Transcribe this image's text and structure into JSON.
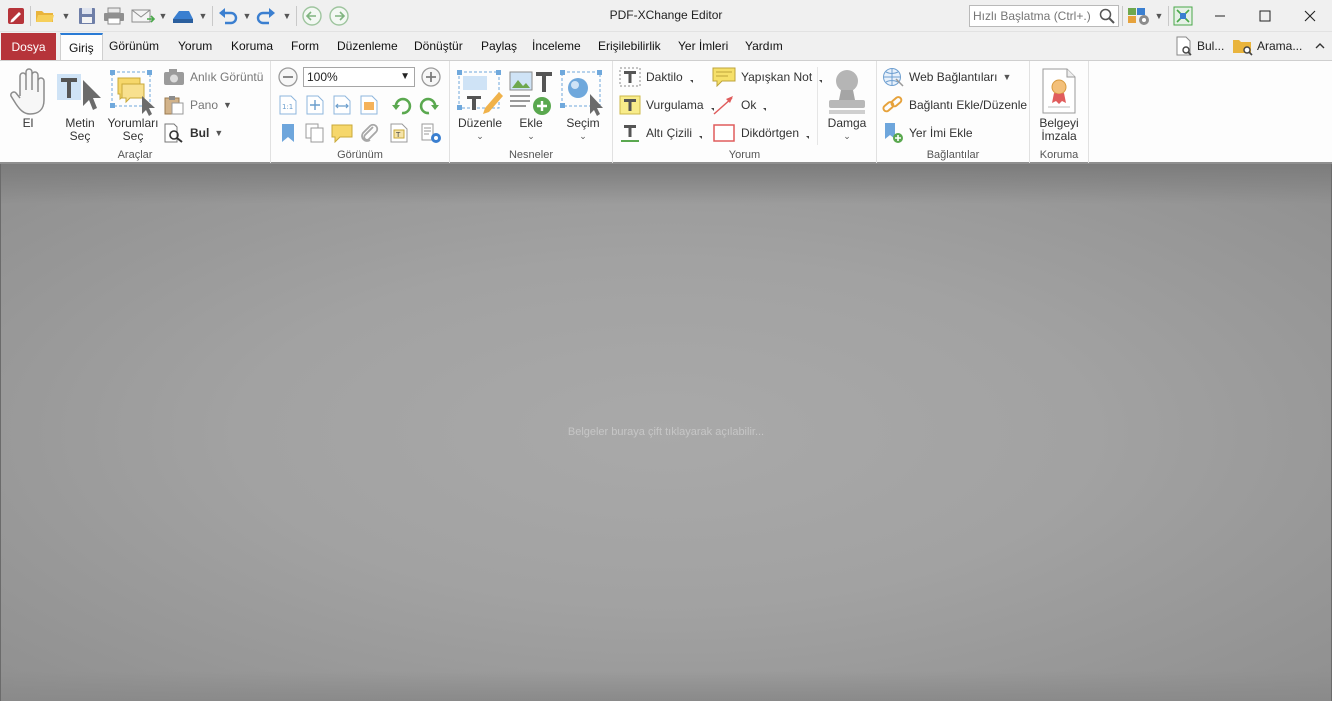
{
  "window": {
    "title": "PDF-XChange Editor",
    "quick_search_placeholder": "Hızlı Başlatma (Ctrl+.)"
  },
  "menu": {
    "file": "Dosya",
    "tabs": [
      "Giriş",
      "Görünüm",
      "Yorum",
      "Koruma",
      "Form",
      "Düzenleme",
      "Dönüştür",
      "Paylaş",
      "İnceleme",
      "Erişilebilirlik",
      "Yer İmleri",
      "Yardım"
    ],
    "active_tab": "Giriş",
    "right_find": "Bul...",
    "right_search": "Arama..."
  },
  "ribbon": {
    "tools": {
      "label": "Araçlar",
      "hand": "El",
      "select_text_1": "Metin",
      "select_text_2": "Seç",
      "select_comments_1": "Yorumları",
      "select_comments_2": "Seç",
      "snapshot": "Anlık Görüntü",
      "clipboard": "Pano",
      "find": "Bul"
    },
    "view": {
      "label": "Görünüm",
      "zoom": "100%"
    },
    "objects": {
      "label": "Nesneler",
      "edit": "Düzenle",
      "add": "Ekle",
      "selection": "Seçim"
    },
    "comment": {
      "label": "Yorum",
      "typewriter": "Daktilo",
      "highlight": "Vurgulama",
      "underline": "Altı Çizili",
      "sticky_note": "Yapışkan Not",
      "arrow": "Ok",
      "rectangle": "Dikdörtgen",
      "stamp": "Damga"
    },
    "links": {
      "label": "Bağlantılar",
      "web_links": "Web Bağlantıları",
      "add_edit_link": "Bağlantı Ekle/Düzenle",
      "add_bookmark": "Yer İmi Ekle"
    },
    "protect": {
      "label": "Koruma",
      "sign_1": "Belgeyi",
      "sign_2": "İmzala"
    }
  },
  "document": {
    "hint": "Belgeler buraya çift tıklayarak açılabilir..."
  },
  "colors": {
    "file_tab": "#b6343a",
    "active_tab_accent": "#2a7bd5",
    "doc_background": "#a4a4a4"
  }
}
